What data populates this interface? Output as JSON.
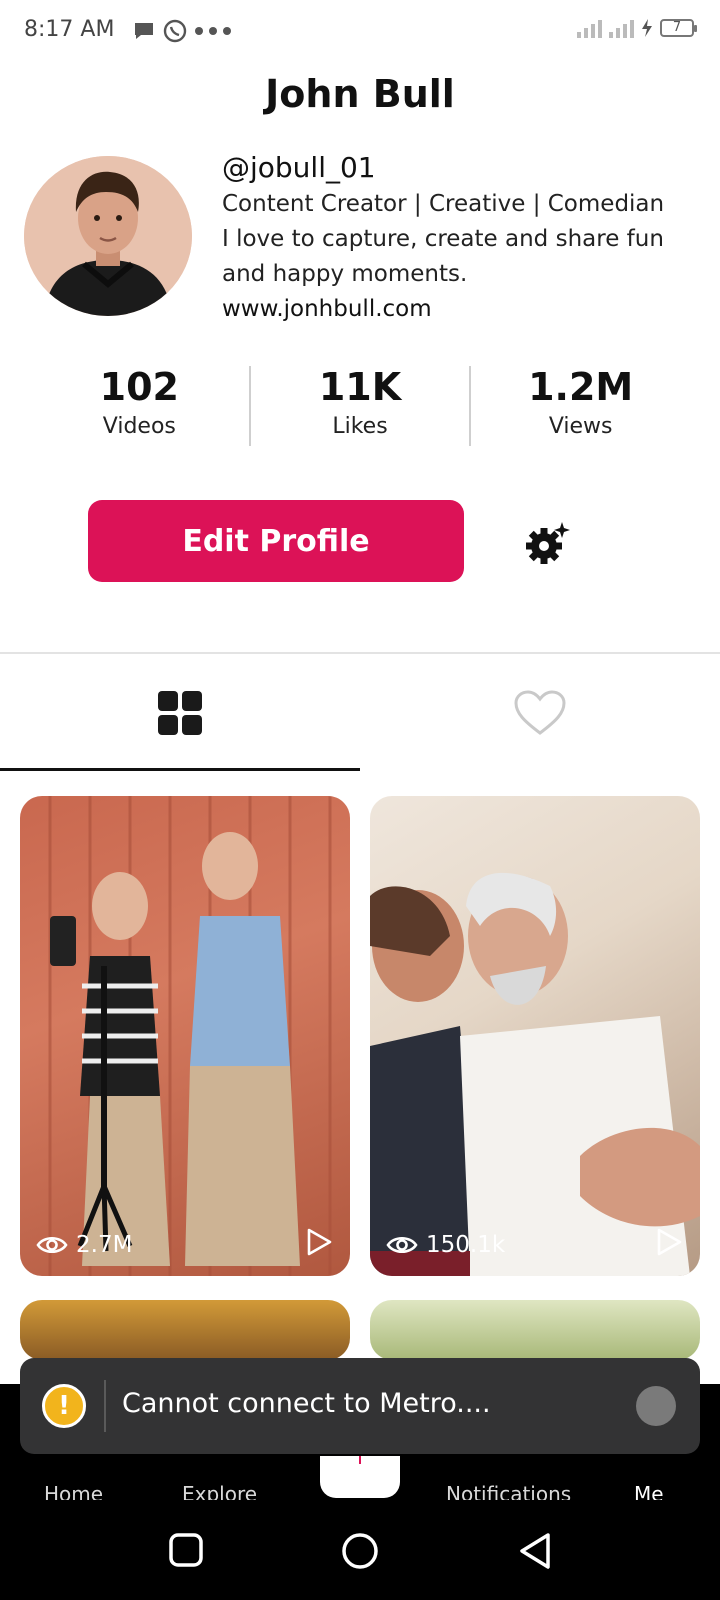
{
  "status_bar": {
    "time": "8:17 AM",
    "battery": "7"
  },
  "profile": {
    "name": "John Bull",
    "handle": "@jobull_01",
    "tagline": "Content Creator | Creative | Comedian",
    "bio": "I love to capture, create and share fun and happy moments.",
    "website": "www.jonhbull.com"
  },
  "stats": [
    {
      "value": "102",
      "label": "Videos"
    },
    {
      "value": "11K",
      "label": "Likes"
    },
    {
      "value": "1.2M",
      "label": "Views"
    }
  ],
  "actions": {
    "edit_label": "Edit Profile"
  },
  "videos": [
    {
      "views": "2.7M"
    },
    {
      "views": "150.1k"
    }
  ],
  "toast": {
    "message": "Cannot connect to Metro...."
  },
  "bottom_nav": {
    "home": "Home",
    "explore": "Explore",
    "notifications": "Notifications",
    "me": "Me"
  },
  "colors": {
    "accent": "#dc1257",
    "toast_bg": "#333334",
    "warn": "#f2b41c"
  }
}
